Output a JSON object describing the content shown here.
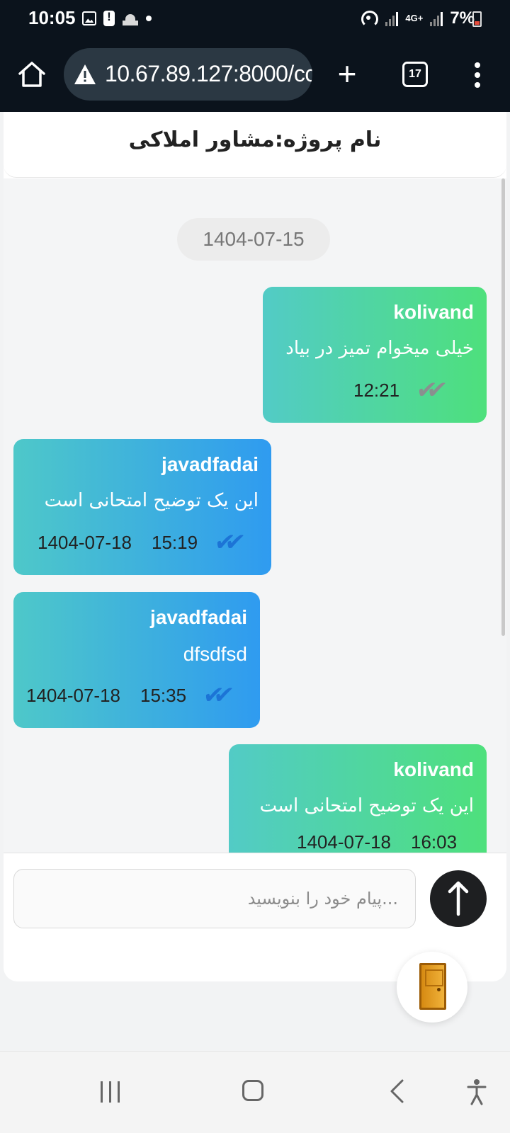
{
  "status_bar": {
    "time": "10:05",
    "network": "4G+",
    "battery": "7%",
    "icons": [
      "image-icon",
      "alert-icon",
      "mosque-icon",
      "dot-icon",
      "hotspot-icon",
      "signal-icon",
      "signal-icon",
      "battery-icon"
    ]
  },
  "browser": {
    "url": "10.67.89.127:8000/cc",
    "tab_count": "17",
    "icons": [
      "home-icon",
      "not-secure-icon",
      "plus-icon",
      "tabs-icon",
      "more-vert-icon"
    ]
  },
  "chat": {
    "title": "نام پروژه:مشاور املاکی",
    "date_separator": "1404-07-15",
    "messages": [
      {
        "sender": "kolivand",
        "text": "خیلی میخوام تمیز در بیاد",
        "date": "",
        "time": "12:21",
        "direction": "sent",
        "status": "delivered"
      },
      {
        "sender": "javadfadai",
        "text": "این یک توضیح امتحانی است",
        "date": "1404-07-18",
        "time": "15:19",
        "direction": "received",
        "status": "read"
      },
      {
        "sender": "javadfadai",
        "text": "dfsdfsd",
        "date": "1404-07-18",
        "time": "15:35",
        "direction": "received",
        "status": "read"
      },
      {
        "sender": "kolivand",
        "text": "این یک توضیح امتحانی است",
        "date": "1404-07-18",
        "time": "16:03",
        "direction": "sent",
        "status": ""
      }
    ],
    "ticks": "✔✔",
    "scroll_down_label": "↓",
    "input_placeholder": "...پیام خود را بنویسید",
    "send_label": "🠕",
    "exit_icon": "door-icon"
  },
  "nav_bar": {
    "icons": [
      "recents-icon",
      "home-icon",
      "back-icon",
      "accessibility-icon"
    ]
  },
  "colors": {
    "sent_bubble": [
      "#52cbc6",
      "#4ee07c"
    ],
    "received_bubble": [
      "#4ec8c9",
      "#2f9bf0"
    ],
    "read_tick": "#1c74d6",
    "delivered_tick": "#8a8f8f",
    "scroll_button": "#0d5a56",
    "send_button": "#1e1f21"
  }
}
